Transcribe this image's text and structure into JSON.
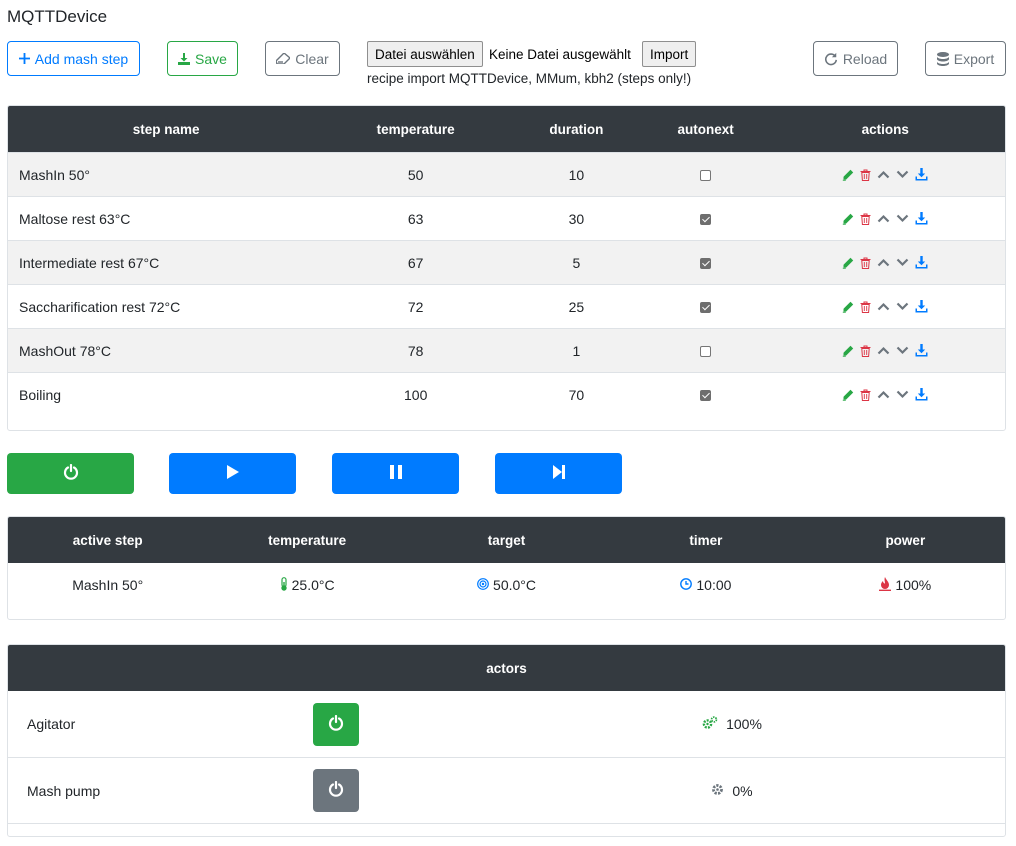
{
  "app_title": "MQTTDevice",
  "toolbar": {
    "add_label": "Add mash step",
    "save_label": "Save",
    "clear_label": "Clear",
    "file_choose_label": "Datei auswählen",
    "file_none_label": "Keine Datei ausgewählt",
    "import_label": "Import",
    "import_hint": "recipe import MQTTDevice, MMum, kbh2 (steps only!)",
    "reload_label": "Reload",
    "export_label": "Export"
  },
  "steps_table": {
    "headers": {
      "name": "step name",
      "temperature": "temperature",
      "duration": "duration",
      "autonext": "autonext",
      "actions": "actions"
    },
    "rows": [
      {
        "name": "MashIn 50°",
        "temperature": "50",
        "duration": "10",
        "autonext": false
      },
      {
        "name": "Maltose rest 63°C",
        "temperature": "63",
        "duration": "30",
        "autonext": true
      },
      {
        "name": "Intermediate rest 67°C",
        "temperature": "67",
        "duration": "5",
        "autonext": true
      },
      {
        "name": "Saccharification rest 72°C",
        "temperature": "72",
        "duration": "25",
        "autonext": true
      },
      {
        "name": "MashOut 78°C",
        "temperature": "78",
        "duration": "1",
        "autonext": false
      },
      {
        "name": "Boiling",
        "temperature": "100",
        "duration": "70",
        "autonext": true
      }
    ]
  },
  "status": {
    "headers": {
      "active_step": "active step",
      "temperature": "temperature",
      "target": "target",
      "timer": "timer",
      "power": "power"
    },
    "values": {
      "active_step": "MashIn 50°",
      "temperature": "25.0°C",
      "target": "50.0°C",
      "timer": "10:00",
      "power": "100%"
    }
  },
  "actors": {
    "header": "actors",
    "items": [
      {
        "name": "Agitator",
        "state": "on",
        "value": "100%"
      },
      {
        "name": "Mash pump",
        "state": "off",
        "value": "0%"
      }
    ]
  },
  "colors": {
    "primary": "#007bff",
    "success": "#28a745",
    "danger": "#dc3545",
    "secondary": "#6c757d",
    "dark": "#343a40"
  }
}
